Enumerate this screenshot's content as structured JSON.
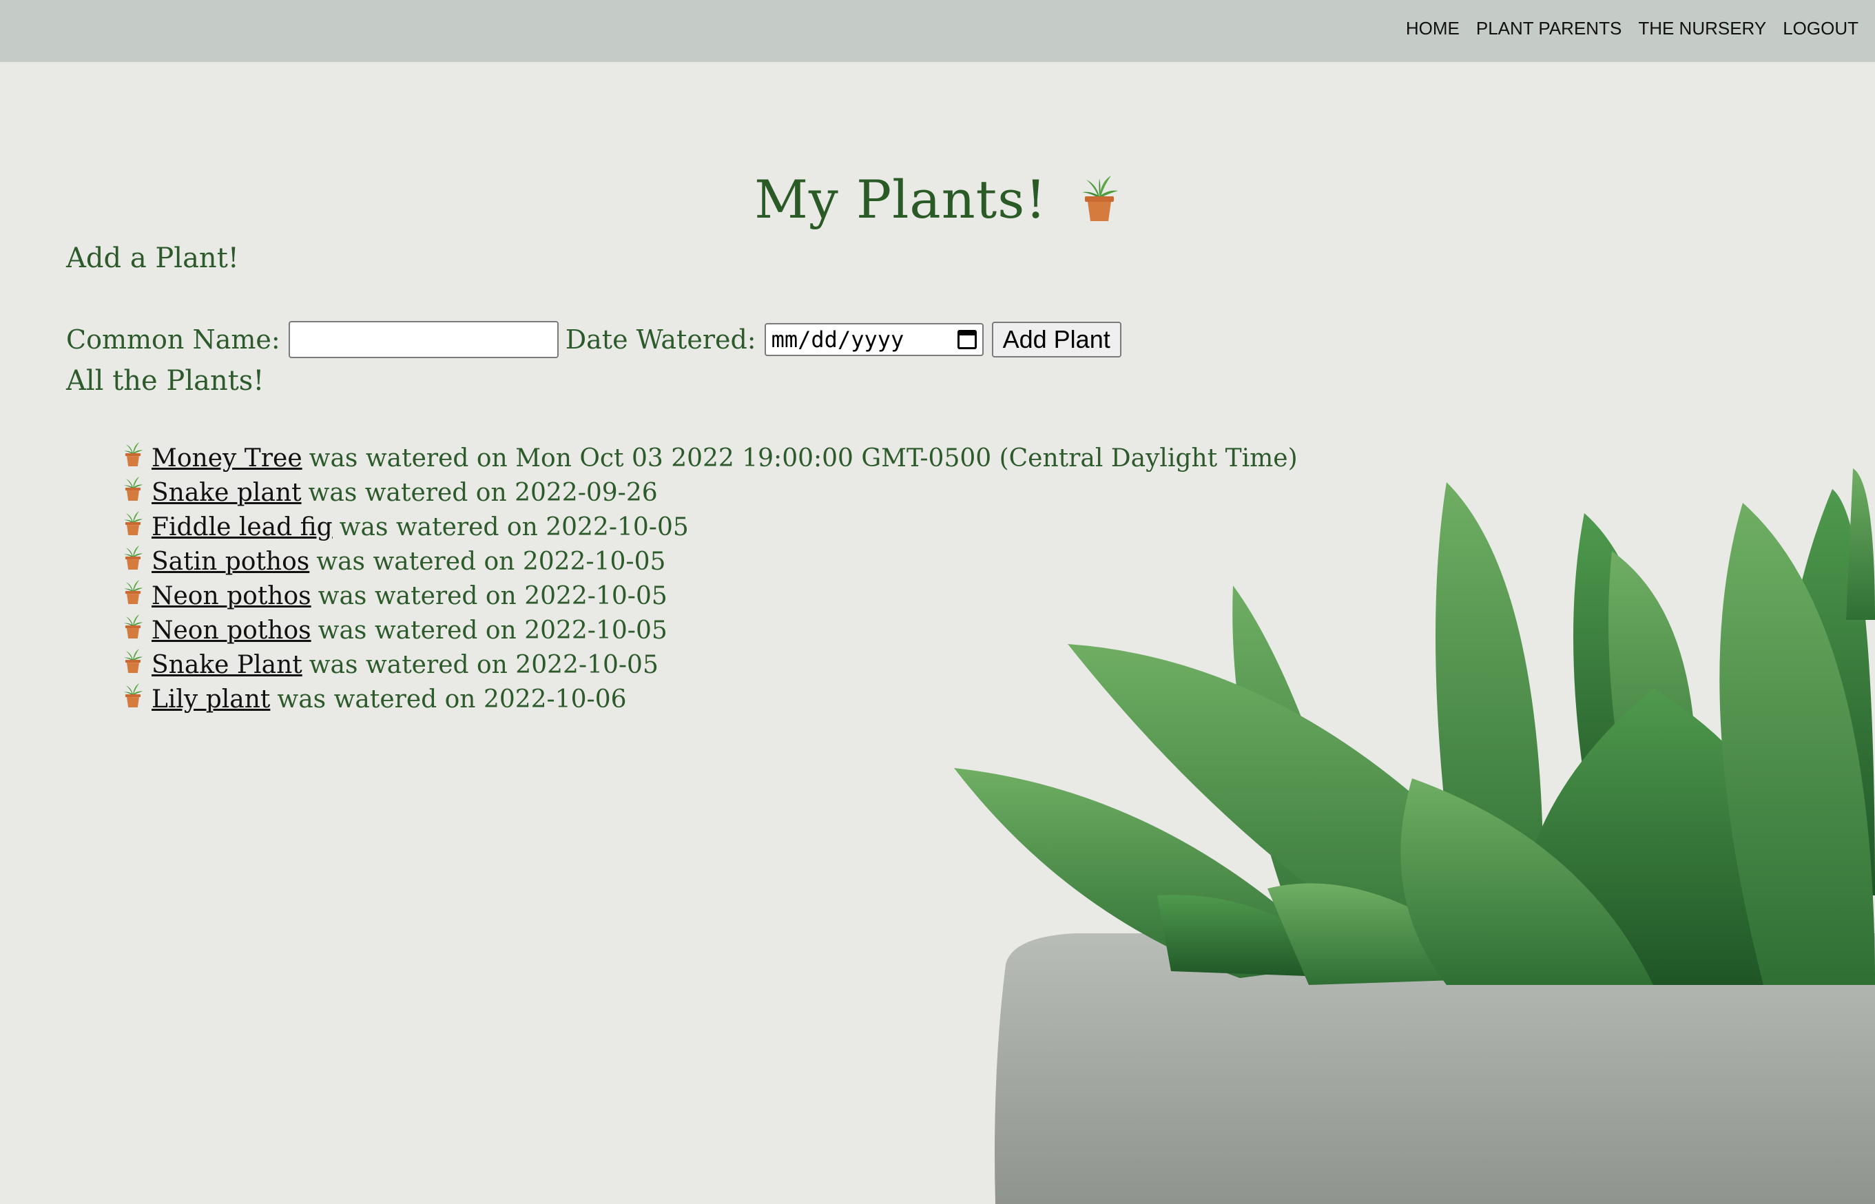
{
  "nav": {
    "items": [
      "HOME",
      "PLANT PARENTS",
      "THE NURSERY",
      "LOGOUT"
    ]
  },
  "page_title": "My Plants!",
  "add_section": {
    "heading": "Add a Plant!",
    "common_name_label": "Common Name:",
    "common_name_value": "",
    "date_label": "Date Watered:",
    "date_placeholder": "mm/dd/yyyy",
    "button_label": "Add Plant"
  },
  "list_section": {
    "heading": "All the Plants!",
    "plants": [
      {
        "name": "Money Tree",
        "rest": "was watered on Mon Oct 03 2022 19:00:00 GMT-0500 (Central Daylight Time)"
      },
      {
        "name": "Snake plant",
        "rest": "was watered on 2022-09-26"
      },
      {
        "name": "Fiddle lead fig",
        "rest": "was watered on 2022-10-05"
      },
      {
        "name": "Satin pothos",
        "rest": "was watered on 2022-10-05"
      },
      {
        "name": "Neon pothos",
        "rest": "was watered on 2022-10-05"
      },
      {
        "name": "Neon pothos",
        "rest": "was watered on 2022-10-05"
      },
      {
        "name": "Snake Plant",
        "rest": "was watered on 2022-10-05"
      },
      {
        "name": "Lily plant",
        "rest": "was watered on 2022-10-06"
      }
    ]
  },
  "colors": {
    "accent_green": "#2d5a2a",
    "topbar": "#c5cbc6",
    "background": "#e9e9e6"
  },
  "icons": {
    "plant_pot": "potted-plant-icon"
  }
}
